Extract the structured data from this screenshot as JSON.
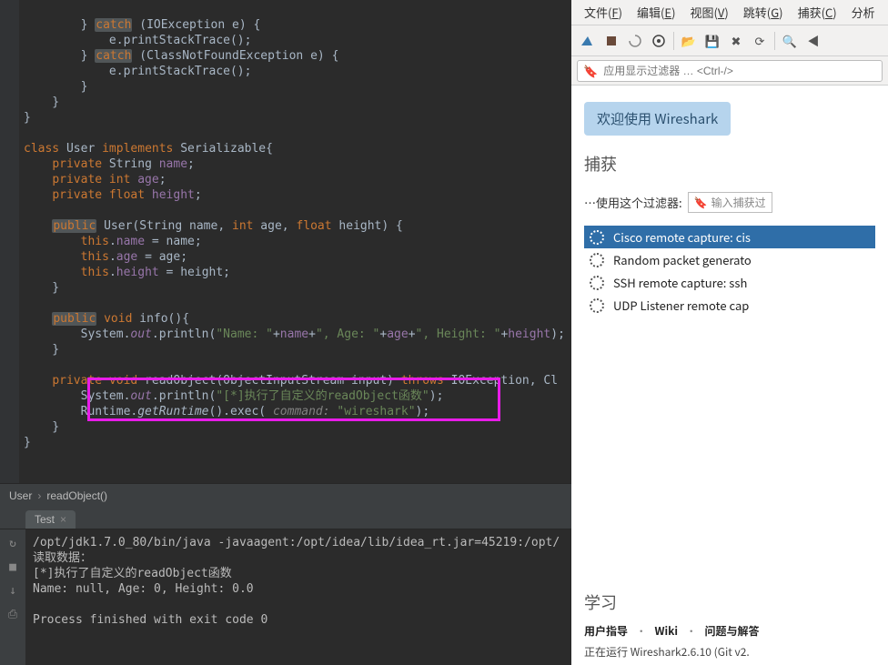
{
  "code": {
    "lines": [
      "        } catch (IOException e) {",
      "            e.printStackTrace();",
      "        } catch (ClassNotFoundException e) {",
      "            e.printStackTrace();",
      "        }",
      "    }",
      "}",
      "",
      "class User implements Serializable{",
      "    private String name;",
      "    private int age;",
      "    private float height;",
      "",
      "    public User(String name, int age, float height) {",
      "        this.name = name;",
      "        this.age = age;",
      "        this.height = height;",
      "    }",
      "",
      "    public void info(){",
      "        System.out.println(\"Name: \"+name+\", Age: \"+age+\", Height: \"+height);",
      "    }",
      "",
      "    private void readObject(ObjectInputStream input) throws IOException, Cl",
      "        System.out.println(\"[*]执行了自定义的readObject函数\");",
      "        Runtime.getRuntime().exec( command: \"wireshark\");",
      "    }",
      "}"
    ]
  },
  "breadcrumb": {
    "class": "User",
    "method": "readObject()"
  },
  "tab": {
    "name": "Test",
    "close": "×"
  },
  "console": {
    "line1": "/opt/jdk1.7.0_80/bin/java -javaagent:/opt/idea/lib/idea_rt.jar=45219:/opt/",
    "line2": "读取数据：",
    "line3": "[*]执行了自定义的readObject函数",
    "line4": "Name: null, Age: 0, Height: 0.0",
    "line5": "",
    "line6": "Process finished with exit code 0"
  },
  "wireshark": {
    "menu": [
      "文件(F)",
      "编辑(E)",
      "视图(V)",
      "跳转(G)",
      "捕获(C)",
      "分析"
    ],
    "filter_placeholder": "应用显示过滤器 … <Ctrl-/>",
    "welcome": "欢迎使用 Wireshark",
    "capture_title": "捕获",
    "capture_hint": "…使用这个过滤器:",
    "capture_input_placeholder": "输入捕获过",
    "interfaces": [
      {
        "label": "Cisco remote capture: cis",
        "selected": true
      },
      {
        "label": "Random packet generato",
        "selected": false
      },
      {
        "label": "SSH remote capture: ssh",
        "selected": false
      },
      {
        "label": "UDP Listener remote cap",
        "selected": false
      }
    ],
    "learn_title": "学习",
    "learn_links": [
      "用户指导",
      "Wiki",
      "问题与解答"
    ],
    "status": "正在运行 Wireshark2.6.10 (Git v2."
  }
}
